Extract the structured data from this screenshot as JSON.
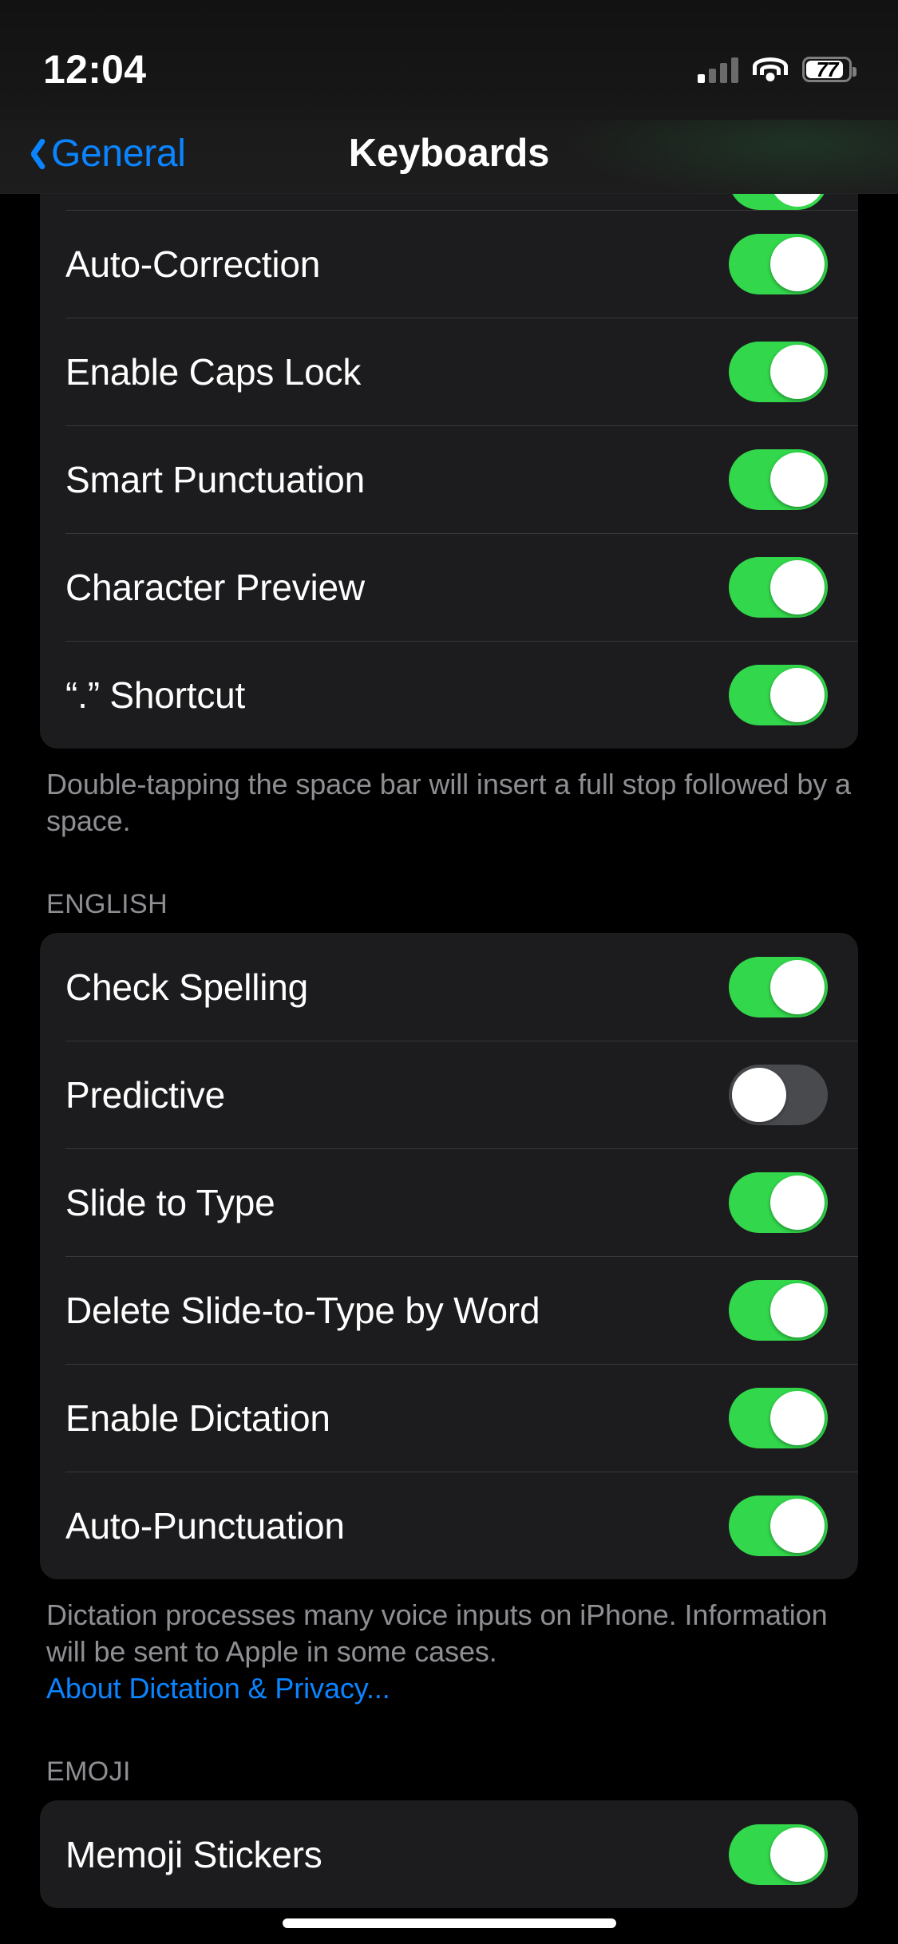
{
  "status_bar": {
    "time": "12:04",
    "battery_percent": "77",
    "cellular_icon": "cellular-signal-icon",
    "wifi_icon": "wifi-icon",
    "battery_icon": "battery-icon"
  },
  "nav": {
    "back_label": "General",
    "back_icon": "chevron-left-icon",
    "title": "Keyboards"
  },
  "groups": [
    {
      "id": "all-keyboards",
      "clipped_top": true,
      "rows": [
        {
          "label": "Auto-Correction",
          "toggle": "on"
        },
        {
          "label": "Enable Caps Lock",
          "toggle": "on"
        },
        {
          "label": "Smart Punctuation",
          "toggle": "on"
        },
        {
          "label": "Character Preview",
          "toggle": "on"
        },
        {
          "label": "“.” Shortcut",
          "toggle": "on"
        }
      ],
      "footer": "Double-tapping the space bar will insert a full stop followed by a space."
    },
    {
      "id": "english",
      "header": "ENGLISH",
      "clipped_top": false,
      "rows": [
        {
          "label": "Check Spelling",
          "toggle": "on"
        },
        {
          "label": "Predictive",
          "toggle": "off"
        },
        {
          "label": "Slide to Type",
          "toggle": "on"
        },
        {
          "label": "Delete Slide-to-Type by Word",
          "toggle": "on"
        },
        {
          "label": "Enable Dictation",
          "toggle": "on"
        },
        {
          "label": "Auto-Punctuation",
          "toggle": "on"
        }
      ],
      "footer": "Dictation processes many voice inputs on iPhone. Information will be sent to Apple in some cases.",
      "footer_link": "About Dictation & Privacy..."
    },
    {
      "id": "emoji",
      "header": "EMOJI",
      "clipped_top": false,
      "rows": [
        {
          "label": "Memoji Stickers",
          "toggle": "on"
        }
      ]
    }
  ],
  "colors": {
    "accent_blue": "#0A84FF",
    "toggle_on_green": "#32D74B",
    "toggle_off_grey": "#484A4D",
    "card_background": "#1C1C1E",
    "page_background": "#000000",
    "secondary_label": "#8E8E93",
    "separator": "#38383A"
  }
}
